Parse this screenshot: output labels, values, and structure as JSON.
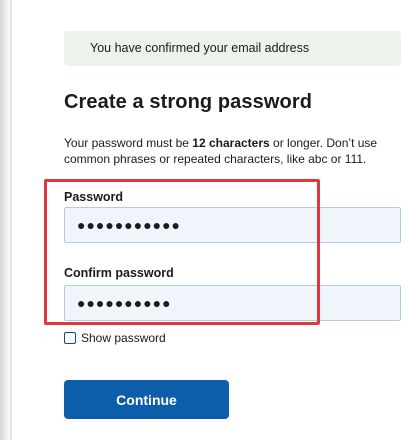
{
  "alert": {
    "text": "You have confirmed your email address"
  },
  "heading": "Create a strong password",
  "description": {
    "part1": "Your password must be ",
    "bold": "12 characters",
    "part2": " or longer. Don’t use common phrases or repeated characters, like abc or 111."
  },
  "password": {
    "label": "Password",
    "value": "●●●●●●●●●●●"
  },
  "confirm_password": {
    "label": "Confirm password",
    "value": "●●●●●●●●●●"
  },
  "show_password": {
    "label": "Show password",
    "checked": false
  },
  "continue_button": {
    "label": "Continue"
  },
  "colors": {
    "primary_button": "#0d5eaa",
    "alert_background": "#ecf3ec",
    "input_background": "#f0f5fb",
    "annotation_highlight": "#e0383f"
  }
}
